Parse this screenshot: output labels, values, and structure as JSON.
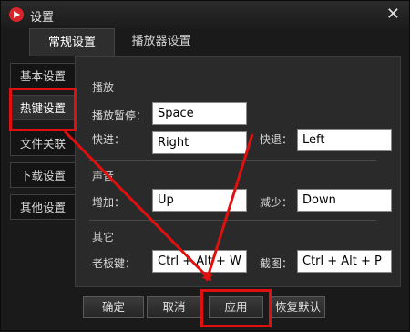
{
  "window": {
    "title": "设置",
    "close_icon": "close-icon"
  },
  "tabs": [
    {
      "label": "常规设置",
      "active": true
    },
    {
      "label": "播放器设置",
      "active": false
    }
  ],
  "sidebar": [
    {
      "label": "基本设置",
      "active": false
    },
    {
      "label": "热键设置",
      "active": true
    },
    {
      "label": "文件关联",
      "active": false
    },
    {
      "label": "下载设置",
      "active": false
    },
    {
      "label": "其他设置",
      "active": false
    }
  ],
  "sections": {
    "playback": {
      "title": "播放",
      "pause_label": "播放暂停：",
      "pause_value": "Space",
      "forward_label": "快进：",
      "forward_value": "Right",
      "rewind_label": "快退：",
      "rewind_value": "Left"
    },
    "sound": {
      "title": "声音",
      "increase_label": "增加：",
      "increase_value": "Up",
      "decrease_label": "减少：",
      "decrease_value": "Down"
    },
    "other": {
      "title": "其它",
      "boss_label": "老板键：",
      "boss_value": "Ctrl + Alt + W",
      "screenshot_label": "截图：",
      "screenshot_value": "Ctrl + Alt + P"
    }
  },
  "buttons": {
    "ok": "确定",
    "cancel": "取消",
    "apply": "应用",
    "restore": "恢复默认"
  },
  "colors": {
    "highlight": "#e01010",
    "logo": "#d7262a"
  }
}
